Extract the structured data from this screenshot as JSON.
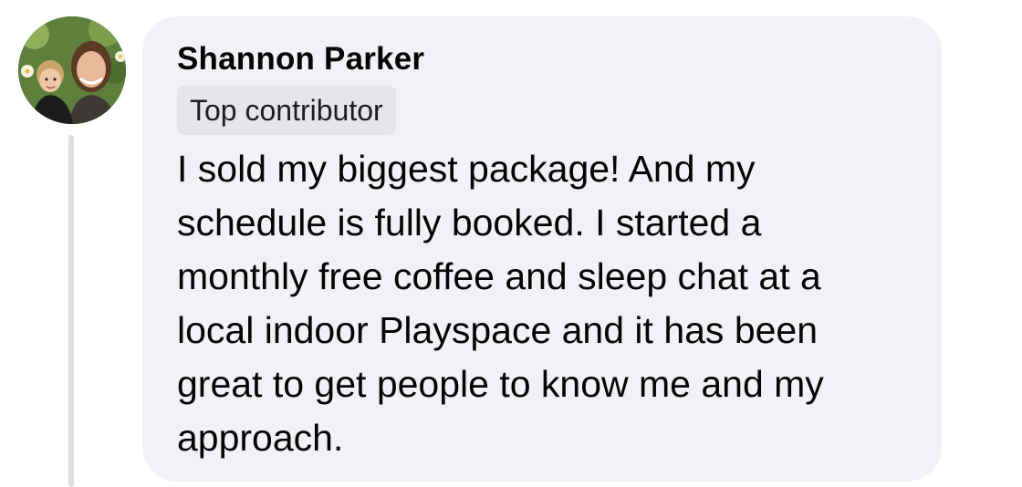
{
  "comment": {
    "author": "Shannon Parker",
    "badge": "Top contributor",
    "text_lines": [
      "I sold my biggest package! And my",
      "schedule is fully booked. I started a",
      "monthly free coffee and sleep chat at a",
      "local indoor Playspace and it has been",
      "great to get people to know me and my",
      "approach."
    ]
  },
  "colors": {
    "bubble_bg": "#f0f2f5",
    "badge_bg": "#e4e6eb",
    "text": "#050505",
    "thread_line": "#dcdee2"
  }
}
